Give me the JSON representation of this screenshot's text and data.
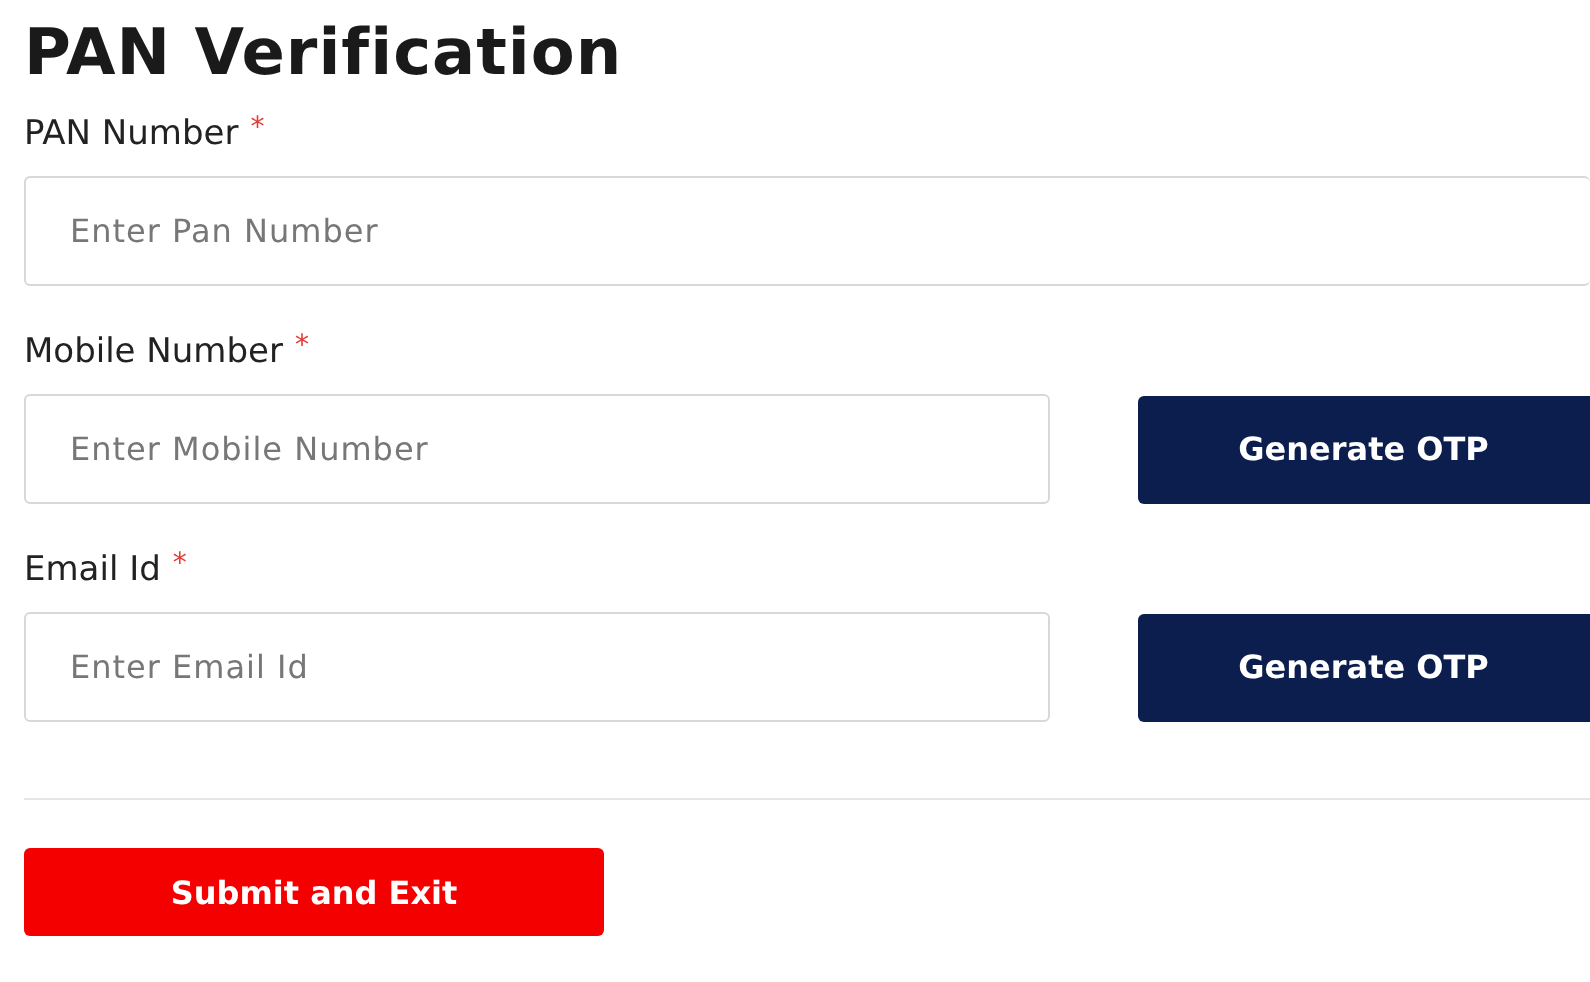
{
  "title": "PAN Verification",
  "fields": [
    {
      "label": "PAN Number",
      "required": true,
      "placeholder": "Enter Pan Number",
      "kind": "wide"
    },
    {
      "label": "Mobile Number",
      "required": true,
      "placeholder": "Enter Mobile Number",
      "kind": "otp",
      "button": "Generate OTP"
    },
    {
      "label": "Email Id",
      "required": true,
      "placeholder": "Enter Email Id",
      "kind": "otp",
      "button": "Generate OTP"
    }
  ],
  "required_mark": "*",
  "submit": "Submit and Exit"
}
